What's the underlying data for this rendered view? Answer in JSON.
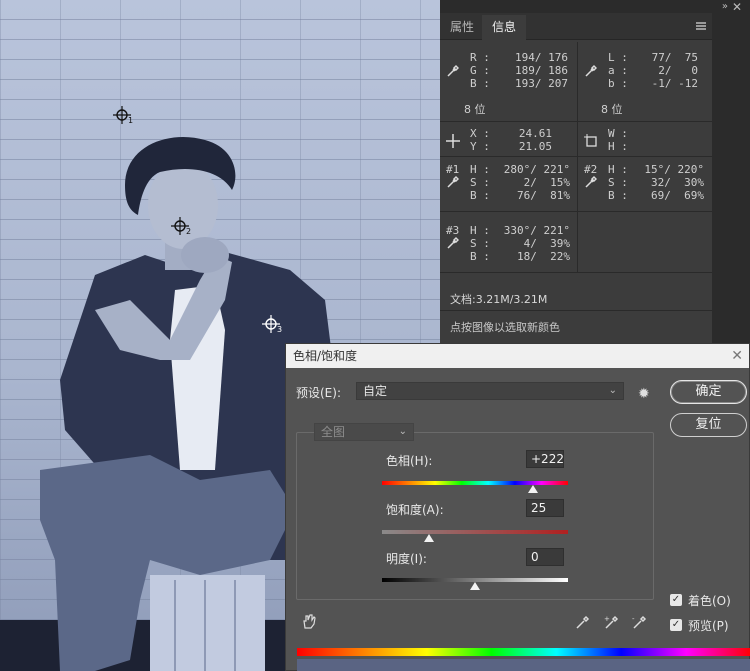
{
  "info_panel": {
    "tabs": [
      "属性",
      "信息"
    ],
    "active_tab": "信息",
    "rgb": {
      "labels": [
        "R :",
        "G :",
        "B :"
      ],
      "values": [
        "194/ 176",
        "189/ 186",
        "193/ 207"
      ]
    },
    "lab": {
      "labels": [
        "L :",
        "a :",
        "b :"
      ],
      "values": [
        "77/  75",
        "2/   0",
        "-1/ -12"
      ]
    },
    "bits_left": "8 位",
    "bits_right": "8 位",
    "xy": {
      "labels": [
        "X :",
        "Y :"
      ],
      "values": [
        "24.61",
        "21.05"
      ]
    },
    "wh": {
      "labels": [
        "W :",
        "H :"
      ],
      "values": [
        "",
        ""
      ]
    },
    "sample1": {
      "id": "#1",
      "labels": [
        "H :",
        "S :",
        "B :"
      ],
      "values": [
        "280°/ 221°",
        "2/  15%",
        "76/  81%"
      ]
    },
    "sample2": {
      "id": "#2",
      "labels": [
        "H :",
        "S :",
        "B :"
      ],
      "values": [
        "15°/ 220°",
        "32/  30%",
        "69/  69%"
      ]
    },
    "sample3": {
      "id": "#3",
      "labels": [
        "H :",
        "S :",
        "B :"
      ],
      "values": [
        "330°/ 221°",
        "4/  39%",
        "18/  22%"
      ]
    },
    "doc_size": "文档:3.21M/3.21M",
    "hint": "点按图像以选取新颜色"
  },
  "samplers": [
    "1",
    "2",
    "3"
  ],
  "dialog": {
    "title": "色相/饱和度",
    "preset_label": "预设(E):",
    "preset_value": "自定",
    "channel_value": "全图",
    "ok_label": "确定",
    "reset_label": "复位",
    "hue_label": "色相(H):",
    "hue_value": "+222",
    "hue_fraction": 0.81,
    "sat_label": "饱和度(A):",
    "sat_value": "25",
    "sat_fraction": 0.25,
    "light_label": "明度(I):",
    "light_value": "0",
    "light_fraction": 0.5,
    "colorize_label": "着色(O)",
    "colorize_checked": true,
    "preview_label": "预览(P)",
    "preview_checked": true
  }
}
